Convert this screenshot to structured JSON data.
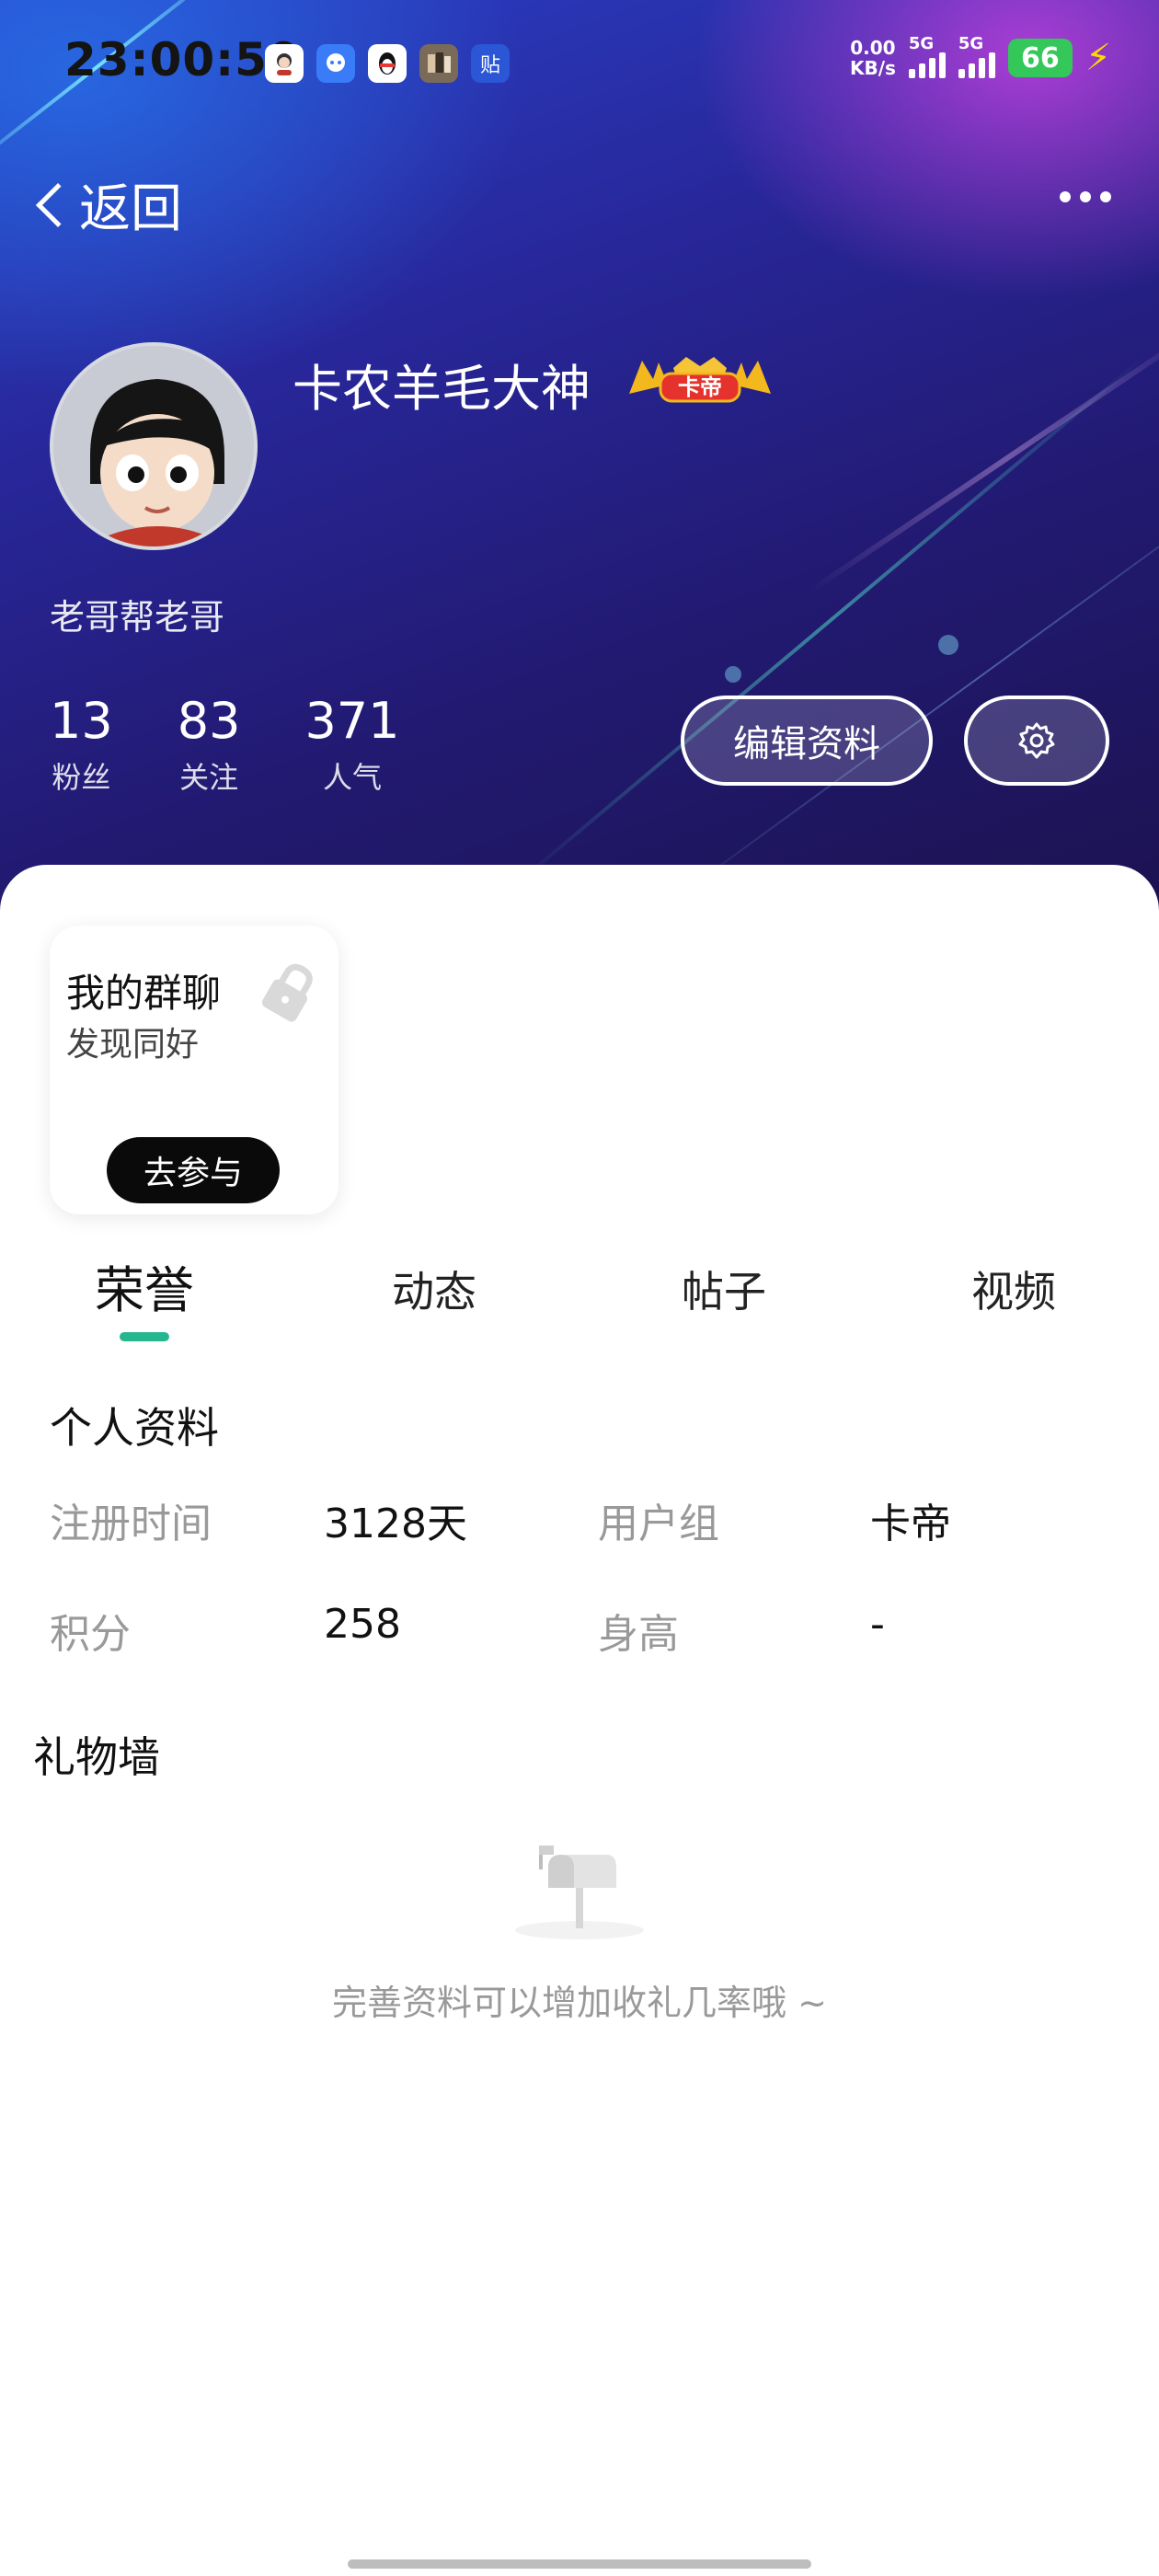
{
  "status_bar": {
    "time": "23:00:50",
    "net_speed_value": "0.00",
    "net_speed_unit": "KB/s",
    "signal1_label": "5G",
    "signal2_label": "5G",
    "battery": "66",
    "notification_icons": [
      "avatar-app-icon",
      "qq-channel-icon",
      "qq-penguin-icon",
      "game-app-icon",
      "tieba-icon"
    ],
    "notif_tieba_glyph": "贴"
  },
  "nav": {
    "back_label": "返回"
  },
  "profile": {
    "username": "卡农羊毛大神",
    "rank_badge": "卡帝",
    "bio": "老哥帮老哥",
    "stats": [
      {
        "value": "13",
        "label": "粉丝"
      },
      {
        "value": "83",
        "label": "关注"
      },
      {
        "value": "371",
        "label": "人气"
      }
    ],
    "edit_label": "编辑资料"
  },
  "group_card": {
    "title": "我的群聊",
    "subtitle": "发现同好",
    "join_label": "去参与"
  },
  "tabs": [
    {
      "label": "荣誉",
      "active": true
    },
    {
      "label": "动态",
      "active": false
    },
    {
      "label": "帖子",
      "active": false
    },
    {
      "label": "视频",
      "active": false
    }
  ],
  "personal_info": {
    "title": "个人资料",
    "rows": [
      [
        {
          "label": "注册时间",
          "value": "3128天"
        },
        {
          "label": "用户组",
          "value": "卡帝"
        }
      ],
      [
        {
          "label": "积分",
          "value": "258"
        },
        {
          "label": "身高",
          "value": "-"
        }
      ]
    ]
  },
  "gift_wall": {
    "title": "礼物墙",
    "empty_text": "完善资料可以增加收礼几率哦 ~"
  },
  "colors": {
    "accent": "#27b78f",
    "battery": "#34c759",
    "header_dark": "#221a72"
  }
}
